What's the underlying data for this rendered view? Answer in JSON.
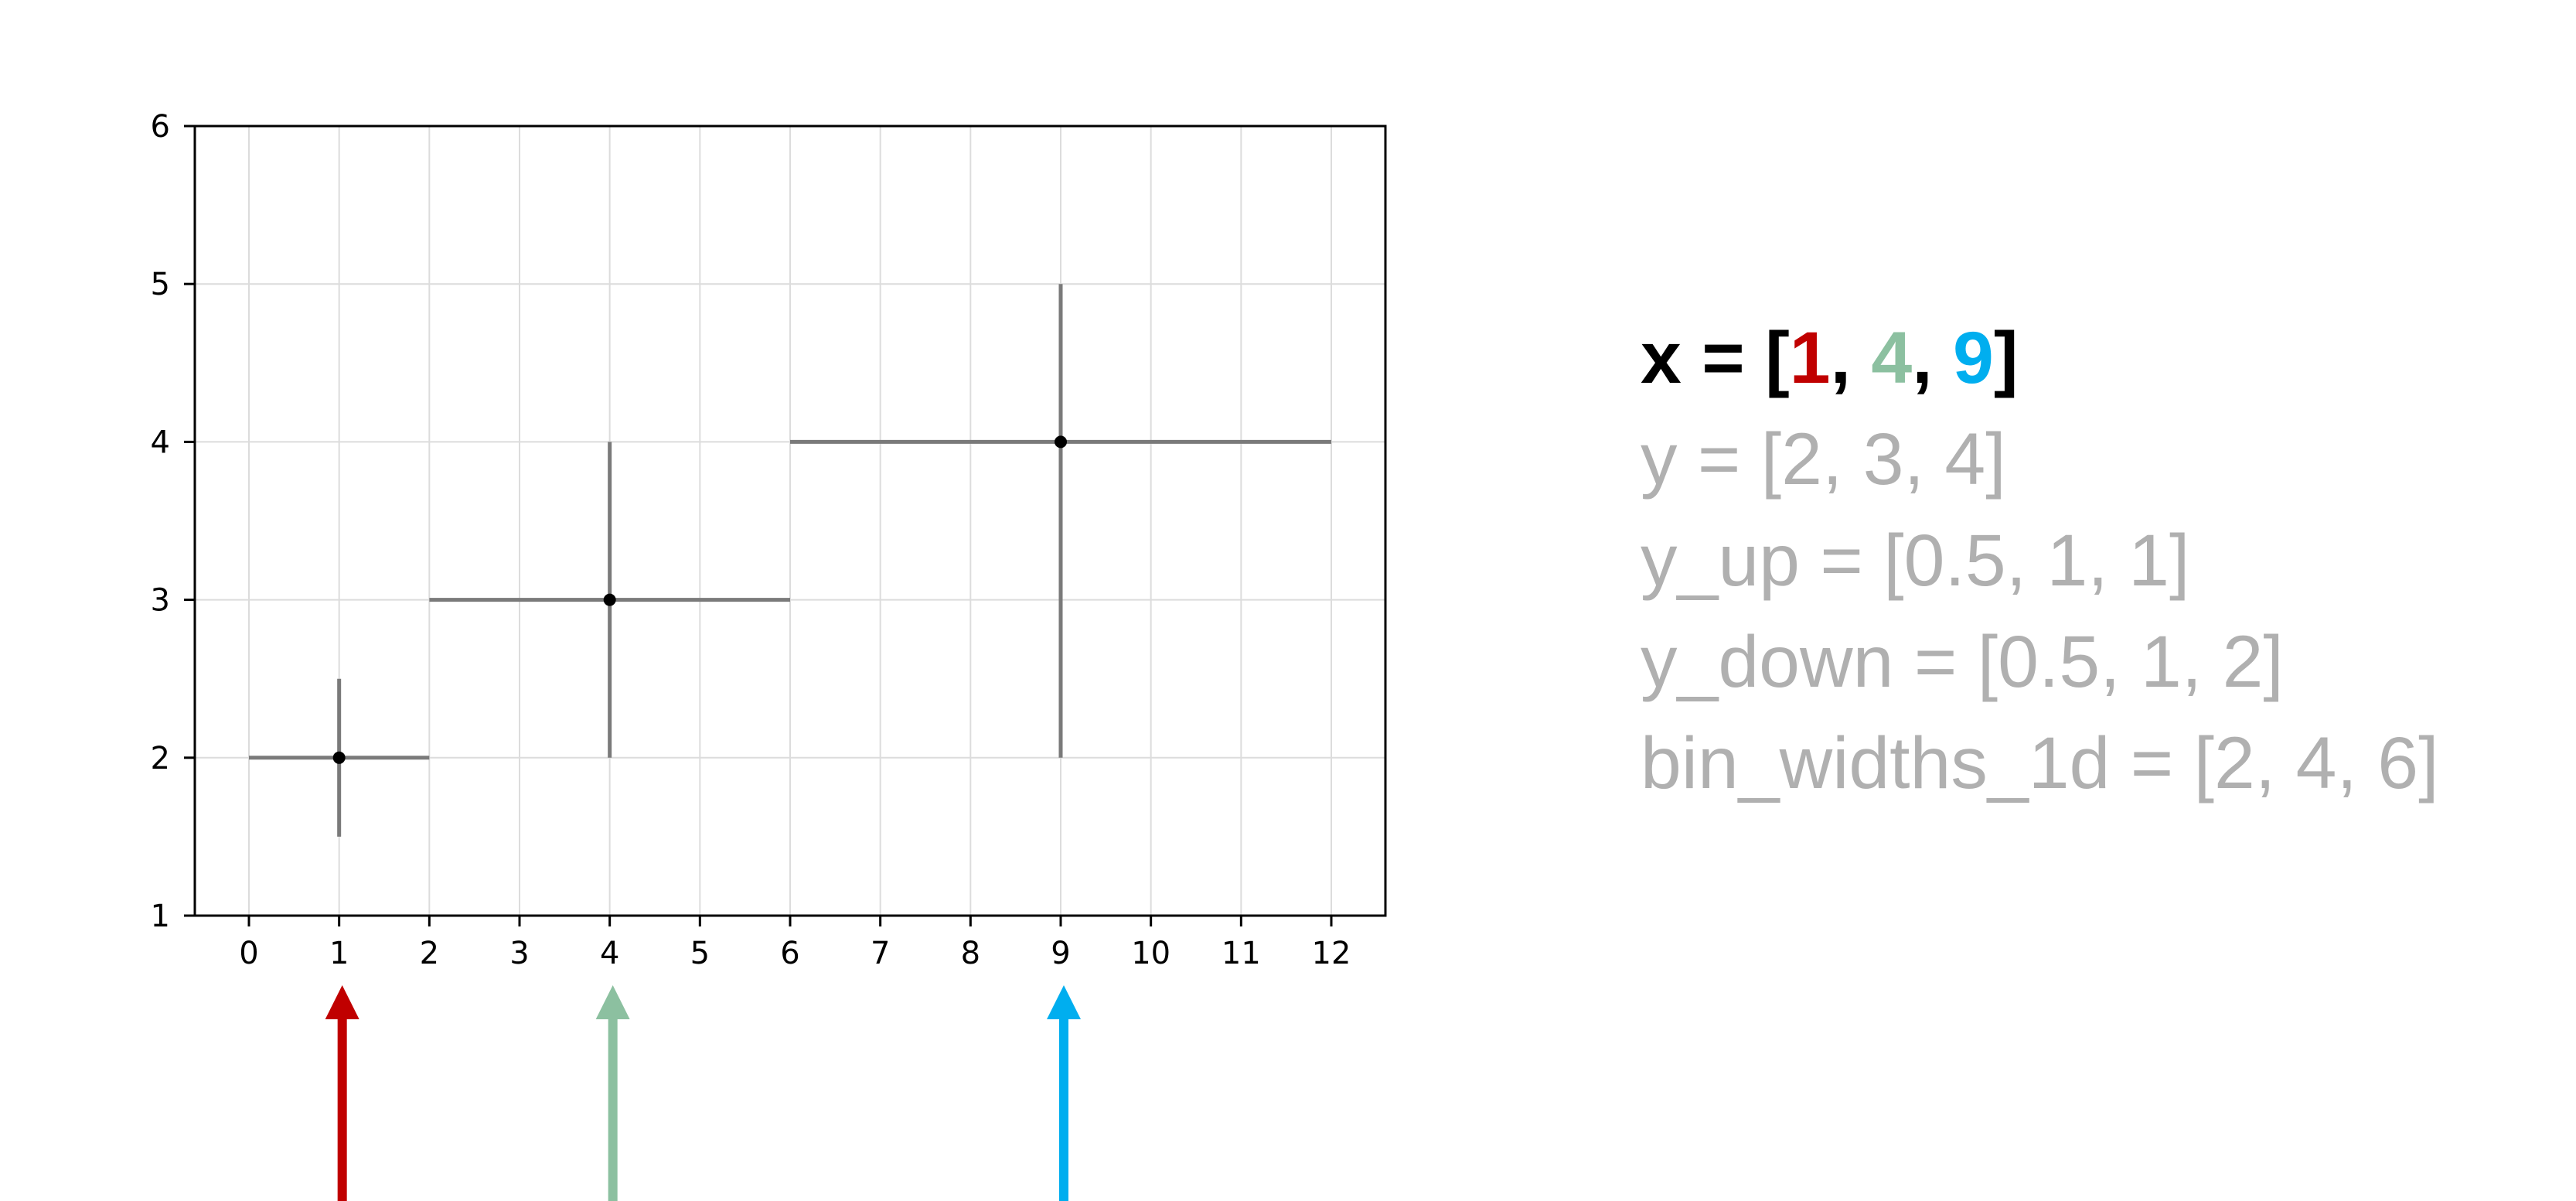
{
  "chart_data": {
    "type": "scatter",
    "points": [
      {
        "x": 1,
        "y": 2,
        "y_up": 0.5,
        "y_down": 0.5,
        "bin_width": 2
      },
      {
        "x": 4,
        "y": 3,
        "y_up": 1,
        "y_down": 1,
        "bin_width": 4
      },
      {
        "x": 9,
        "y": 4,
        "y_up": 1,
        "y_down": 2,
        "bin_width": 6
      }
    ],
    "xlim": [
      -0.6,
      12.6
    ],
    "ylim": [
      1,
      6
    ],
    "xticks": [
      "0",
      "1",
      "2",
      "3",
      "4",
      "5",
      "6",
      "7",
      "8",
      "9",
      "10",
      "11",
      "12"
    ],
    "yticks": [
      "1",
      "2",
      "3",
      "4",
      "5",
      "6"
    ],
    "grid": true,
    "errorbar_color": "#7a7a7a",
    "marker_color": "#000000",
    "arrows": [
      {
        "x": 1,
        "color": "#c00000"
      },
      {
        "x": 4,
        "color": "#8cc0a0"
      },
      {
        "x": 9,
        "color": "#00aeef"
      }
    ]
  },
  "code": {
    "x_prefix": "x = [",
    "x_vals": [
      "1",
      "4",
      "9"
    ],
    "x_sep": ", ",
    "x_suffix": "]",
    "x_colors": [
      "#c00000",
      "#8cc0a0",
      "#00aeef"
    ],
    "y_line": "y = [2, 3, 4]",
    "y_up_line": "y_up = [0.5, 1, 1]",
    "y_down_line": "y_down = [0.5, 1, 2]",
    "bin_widths_line": "bin_widths_1d = [2, 4, 6]"
  }
}
